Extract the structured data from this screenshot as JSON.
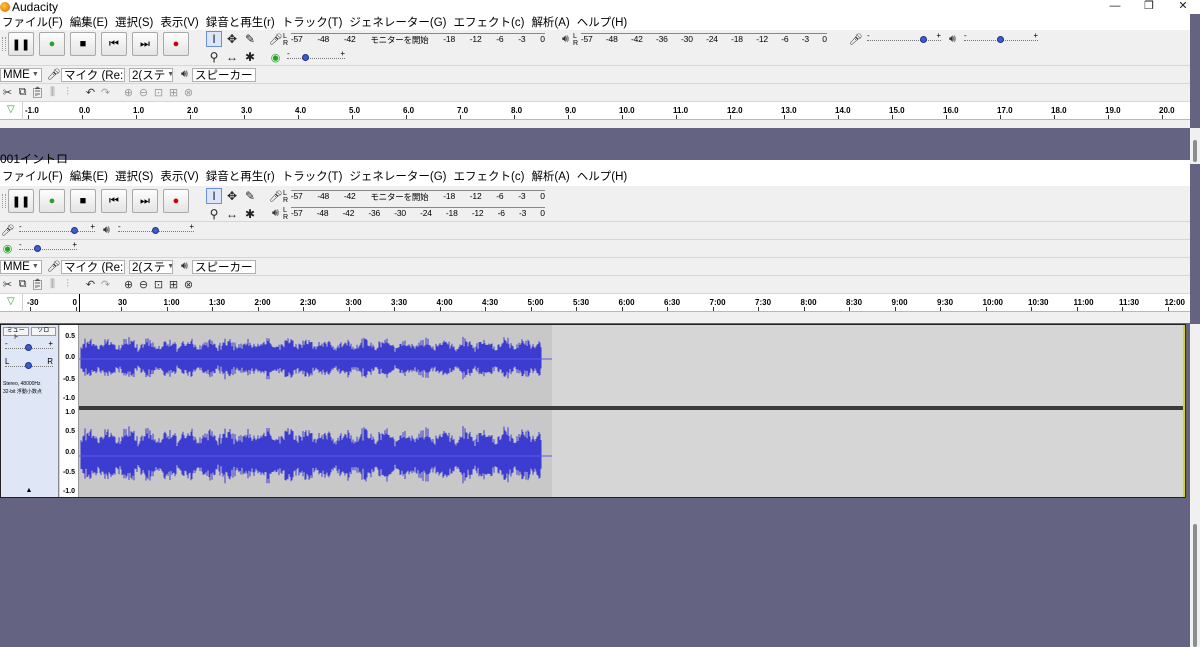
{
  "app_title": "Audacity",
  "project_title": "001イントロ",
  "window_buttons": [
    "—",
    "❐",
    "✕"
  ],
  "menu": [
    "ファイル(F)",
    "編集(E)",
    "選択(S)",
    "表示(V)",
    "録音と再生(r)",
    "トラック(T)",
    "ジェネレーター(G)",
    "エフェクト(c)",
    "解析(A)",
    "ヘルプ(H)"
  ],
  "transport": [
    {
      "name": "pause",
      "glyph": "❚❚"
    },
    {
      "name": "play",
      "glyph": "●"
    },
    {
      "name": "stop",
      "glyph": "■"
    },
    {
      "name": "skip-start",
      "glyph": "⏮"
    },
    {
      "name": "skip-end",
      "glyph": "⏭"
    },
    {
      "name": "record",
      "glyph": "●"
    }
  ],
  "record_meter": {
    "scale": [
      "-57",
      "-48",
      "-42",
      "モニターを開始",
      "-18",
      "-12",
      "-6",
      "-3",
      "0"
    ],
    "scale_full": [
      "-57",
      "-48",
      "-42",
      "-36",
      "-30",
      "-24",
      "-18",
      "-12",
      "-6",
      "-3",
      "0"
    ],
    "monitor_text": "モニターを開始"
  },
  "play_meter": {
    "scale": [
      "-57",
      "-48",
      "-42",
      "-36",
      "-30",
      "-24",
      "-18",
      "-12",
      "-6",
      "-3",
      "0"
    ]
  },
  "channel_labels": [
    "L",
    "R"
  ],
  "slider_min": "-",
  "slider_max": "+",
  "sliders": {
    "record_volume": 0.77,
    "play_volume": 0.5,
    "play_speed": 0.3,
    "top_record_volume": 0.8,
    "top_play_volume": 0.5,
    "top_play_speed": 0.3
  },
  "device": {
    "host": "MME",
    "recording_device": "マイク (Re:",
    "channels": "2(ステ",
    "playback_device": "スピーカー ("
  },
  "ruler_top": [
    "-1.0",
    "0.0",
    "1.0",
    "2.0",
    "3.0",
    "4.0",
    "5.0",
    "6.0",
    "7.0",
    "8.0",
    "9.0",
    "10.0",
    "11.0",
    "12.0",
    "13.0",
    "14.0",
    "15.0",
    "16.0",
    "17.0",
    "18.0",
    "19.0",
    "20.0"
  ],
  "ruler_main": [
    "-30",
    "0",
    "30",
    "1:00",
    "1:30",
    "2:00",
    "2:30",
    "3:00",
    "3:30",
    "4:00",
    "4:30",
    "5:00",
    "5:30",
    "6:00",
    "6:30",
    "7:00",
    "7:30",
    "8:00",
    "8:30",
    "9:00",
    "9:30",
    "10:00",
    "10:30",
    "11:00",
    "11:30",
    "12:00"
  ],
  "track": {
    "mute": "ミュート",
    "solo": "ソロ",
    "pan_left": "L",
    "pan_right": "R",
    "info_line1": "Stereo, 48000Hz",
    "info_line2": "32-bit 浮動小数点",
    "gain": 0.5,
    "pan": 0.5,
    "collapse": "▲",
    "vruler_top": [
      "0.5",
      "0.0",
      "-0.5",
      "-1.0"
    ],
    "vruler_bottom": [
      "1.0",
      "0.5",
      "0.0",
      "-0.5",
      "-1.0"
    ]
  },
  "colors": {
    "background": "#646482",
    "waveform": "#3c3cd0",
    "record": "#cc0000",
    "play": "#2aa12a",
    "selection": "#c8c8c8"
  }
}
